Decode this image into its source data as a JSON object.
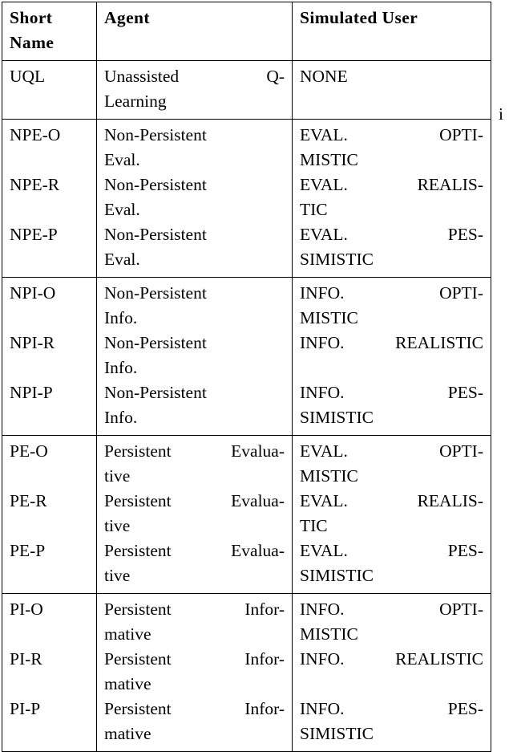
{
  "table": {
    "caption_text": "",
    "columns": [
      {
        "key": "short_name",
        "header": "Short Name",
        "header_l1": "Short",
        "header_l2": "Name"
      },
      {
        "key": "agent",
        "header": "Agent",
        "header_l1": "Agent",
        "header_l2": ""
      },
      {
        "key": "simulated_user",
        "header": "Simulated User",
        "header_l1": "Simulated User",
        "header_l2": ""
      }
    ],
    "groups": [
      {
        "id": "uql",
        "rows": [
          {
            "short_name": "UQL",
            "agent": "Unassisted Q-Learning",
            "agent_lines": [
              {
                "type": "spread",
                "left": "Unassisted",
                "right": "Q-"
              },
              {
                "type": "plain",
                "text": "Learning"
              }
            ],
            "simulated_user": "NONE",
            "user_lines": [
              {
                "type": "plain",
                "text": "NONE"
              }
            ]
          }
        ]
      },
      {
        "id": "npe",
        "rows": [
          {
            "short_name": "NPE-O",
            "agent": "Non-Persistent Eval.",
            "agent_lines": [
              {
                "type": "plain",
                "text": "Non-Persistent"
              },
              {
                "type": "plain",
                "text": "Eval."
              }
            ],
            "simulated_user": "EVAL. OPTIMISTIC",
            "user_lines": [
              {
                "type": "spread",
                "left": "EVAL.",
                "right": "OPTI-"
              },
              {
                "type": "plain",
                "text": "MISTIC"
              }
            ]
          },
          {
            "short_name": "NPE-R",
            "agent": "Non-Persistent Eval.",
            "agent_lines": [
              {
                "type": "plain",
                "text": "Non-Persistent"
              },
              {
                "type": "plain",
                "text": "Eval."
              }
            ],
            "simulated_user": "EVAL. REALISTIC",
            "user_lines": [
              {
                "type": "spread",
                "left": "EVAL.",
                "right": "REALIS-"
              },
              {
                "type": "plain",
                "text": "TIC"
              }
            ]
          },
          {
            "short_name": "NPE-P",
            "agent": "Non-Persistent Eval.",
            "agent_lines": [
              {
                "type": "plain",
                "text": "Non-Persistent"
              },
              {
                "type": "plain",
                "text": "Eval."
              }
            ],
            "simulated_user": "EVAL. PESSIMISTIC",
            "user_lines": [
              {
                "type": "spread",
                "left": "EVAL.",
                "right": "PES-"
              },
              {
                "type": "plain",
                "text": "SIMISTIC"
              }
            ]
          }
        ]
      },
      {
        "id": "npi",
        "rows": [
          {
            "short_name": "NPI-O",
            "agent": "Non-Persistent Info.",
            "agent_lines": [
              {
                "type": "plain",
                "text": "Non-Persistent"
              },
              {
                "type": "plain",
                "text": "Info."
              }
            ],
            "simulated_user": "INFO. OPTIMISTIC",
            "user_lines": [
              {
                "type": "spread",
                "left": "INFO.",
                "right": "OPTI-"
              },
              {
                "type": "plain",
                "text": "MISTIC"
              }
            ]
          },
          {
            "short_name": "NPI-R",
            "agent": "Non-Persistent Info.",
            "agent_lines": [
              {
                "type": "plain",
                "text": "Non-Persistent"
              },
              {
                "type": "plain",
                "text": "Info."
              }
            ],
            "simulated_user": "INFO. REALISTIC",
            "user_lines": [
              {
                "type": "full",
                "left": "INFO.",
                "right": "REALISTIC"
              },
              {
                "type": "blank",
                "text": ""
              }
            ]
          },
          {
            "short_name": "NPI-P",
            "agent": "Non-Persistent Info.",
            "agent_lines": [
              {
                "type": "plain",
                "text": "Non-Persistent"
              },
              {
                "type": "plain",
                "text": "Info."
              }
            ],
            "simulated_user": "INFO. PESSIMISTIC",
            "user_lines": [
              {
                "type": "spread",
                "left": "INFO.",
                "right": "PES-"
              },
              {
                "type": "plain",
                "text": "SIMISTIC"
              }
            ]
          }
        ]
      },
      {
        "id": "pe",
        "rows": [
          {
            "short_name": "PE-O",
            "agent": "Persistent Evaluative",
            "agent_lines": [
              {
                "type": "spread",
                "left": "Persistent",
                "right": "Evalua-"
              },
              {
                "type": "plain",
                "text": "tive"
              }
            ],
            "simulated_user": "EVAL. OPTIMISTIC",
            "user_lines": [
              {
                "type": "spread",
                "left": "EVAL.",
                "right": "OPTI-"
              },
              {
                "type": "plain",
                "text": "MISTIC"
              }
            ]
          },
          {
            "short_name": "PE-R",
            "agent": "Persistent Evaluative",
            "agent_lines": [
              {
                "type": "spread",
                "left": "Persistent",
                "right": "Evalua-"
              },
              {
                "type": "plain",
                "text": "tive"
              }
            ],
            "simulated_user": "EVAL. REALISTIC",
            "user_lines": [
              {
                "type": "spread",
                "left": "EVAL.",
                "right": "REALIS-"
              },
              {
                "type": "plain",
                "text": "TIC"
              }
            ]
          },
          {
            "short_name": "PE-P",
            "agent": "Persistent Evaluative",
            "agent_lines": [
              {
                "type": "spread",
                "left": "Persistent",
                "right": "Evalua-"
              },
              {
                "type": "plain",
                "text": "tive"
              }
            ],
            "simulated_user": "EVAL. PESSIMISTIC",
            "user_lines": [
              {
                "type": "spread",
                "left": "EVAL.",
                "right": "PES-"
              },
              {
                "type": "plain",
                "text": "SIMISTIC"
              }
            ]
          }
        ]
      },
      {
        "id": "pi",
        "rows": [
          {
            "short_name": "PI-O",
            "agent": "Persistent Informative",
            "agent_lines": [
              {
                "type": "spread",
                "left": "Persistent",
                "right": "Infor-"
              },
              {
                "type": "plain",
                "text": "mative"
              }
            ],
            "simulated_user": "INFO. OPTIMISTIC",
            "user_lines": [
              {
                "type": "spread",
                "left": "INFO.",
                "right": "OPTI-"
              },
              {
                "type": "plain",
                "text": "MISTIC"
              }
            ]
          },
          {
            "short_name": "PI-R",
            "agent": "Persistent Informative",
            "agent_lines": [
              {
                "type": "spread",
                "left": "Persistent",
                "right": "Infor-"
              },
              {
                "type": "plain",
                "text": "mative"
              }
            ],
            "simulated_user": "INFO. REALISTIC",
            "user_lines": [
              {
                "type": "full",
                "left": "INFO.",
                "right": "REALISTIC"
              },
              {
                "type": "blank",
                "text": ""
              }
            ]
          },
          {
            "short_name": "PI-P",
            "agent": "Persistent Informative",
            "agent_lines": [
              {
                "type": "spread",
                "left": "Persistent",
                "right": "Infor-"
              },
              {
                "type": "plain",
                "text": "mative"
              }
            ],
            "simulated_user": "INFO. PESSIMISTIC",
            "user_lines": [
              {
                "type": "spread",
                "left": "INFO.",
                "right": "PES-"
              },
              {
                "type": "plain",
                "text": "SIMISTIC"
              }
            ]
          }
        ]
      }
    ]
  },
  "margin_artifact": {
    "text": "i"
  },
  "colors": {
    "text": "#000000",
    "rule": "#000000",
    "background": "#ffffff"
  }
}
